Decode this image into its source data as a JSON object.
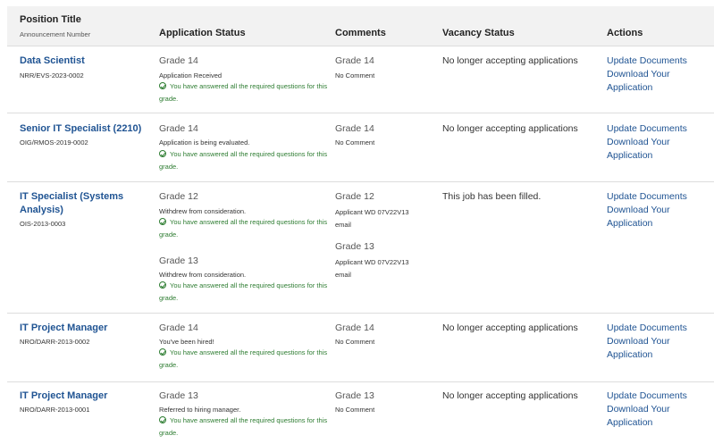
{
  "header": {
    "position_title": "Position Title",
    "announcement_number": "Announcement Number",
    "application_status": "Application Status",
    "comments": "Comments",
    "vacancy_status": "Vacancy Status",
    "actions": "Actions"
  },
  "answered_note": "You have answered all the required questions for this grade.",
  "actions": {
    "update": "Update Documents",
    "download": "Download Your Application"
  },
  "rows": [
    {
      "title": "Data Scientist",
      "announcement": "NRR/EVS-2023-0002",
      "vacancy": "No longer accepting applications",
      "grades": [
        {
          "grade": "Grade 14",
          "status": "Application Received",
          "comment_grade": "Grade 14",
          "comment": "No Comment"
        }
      ]
    },
    {
      "title": "Senior IT Specialist (2210)",
      "announcement": "OIG/RMOS-2019-0002",
      "vacancy": "No longer accepting applications",
      "grades": [
        {
          "grade": "Grade 14",
          "status": "Application is being evaluated.",
          "comment_grade": "Grade 14",
          "comment": "No Comment"
        }
      ]
    },
    {
      "title": "IT Specialist (Systems Analysis)",
      "announcement": "OIS-2013-0003",
      "vacancy": "This job has been filled.",
      "grades": [
        {
          "grade": "Grade 12",
          "status": "Withdrew from consideration.",
          "comment_grade": "Grade 12",
          "comment": "Applicant WD 07V22V13 email"
        },
        {
          "grade": "Grade 13",
          "status": "Withdrew from consideration.",
          "comment_grade": "Grade 13",
          "comment": "Applicant WD 07V22V13 email"
        }
      ]
    },
    {
      "title": "IT Project Manager",
      "announcement": "NRO/DARR-2013-0002",
      "vacancy": "No longer accepting applications",
      "grades": [
        {
          "grade": "Grade 14",
          "status": "You've been hired!",
          "comment_grade": "Grade 14",
          "comment": "No Comment"
        }
      ]
    },
    {
      "title": "IT Project Manager",
      "announcement": "NRO/DARR-2013-0001",
      "vacancy": "No longer accepting applications",
      "grades": [
        {
          "grade": "Grade 13",
          "status": "Referred to hiring manager.",
          "comment_grade": "Grade 13",
          "comment": "No Comment"
        }
      ]
    }
  ]
}
